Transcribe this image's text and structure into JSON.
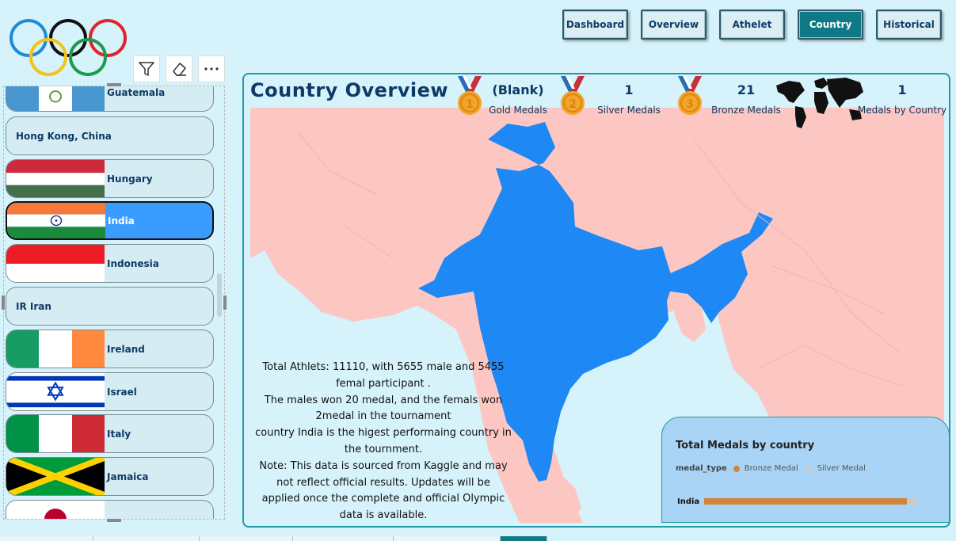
{
  "nav": {
    "items": [
      "Dashboard",
      "Overview",
      "Athelet",
      "Country",
      "Historical"
    ],
    "active": "Country"
  },
  "slicer": {
    "toolbar": [
      "filter-icon",
      "eraser-icon",
      "more-options-icon"
    ],
    "countries": [
      {
        "label": "Guatemala",
        "flag": "guatemala"
      },
      {
        "label": "Hong Kong, China",
        "flag": ""
      },
      {
        "label": "Hungary",
        "flag": "hungary"
      },
      {
        "label": "India",
        "flag": "india",
        "selected": true
      },
      {
        "label": "Indonesia",
        "flag": "indonesia"
      },
      {
        "label": "IR Iran",
        "flag": ""
      },
      {
        "label": "Ireland",
        "flag": "ireland"
      },
      {
        "label": "Israel",
        "flag": "israel"
      },
      {
        "label": "Italy",
        "flag": "italy"
      },
      {
        "label": "Jamaica",
        "flag": "jamaica"
      },
      {
        "label": "",
        "flag": "japan"
      }
    ]
  },
  "panel": {
    "title": "Country Overview",
    "kpis": {
      "gold": {
        "value": "(Blank)",
        "label": "Gold Medals",
        "medal": "1"
      },
      "silver": {
        "value": "1",
        "label": "Silver Medals",
        "medal": "2"
      },
      "bronze": {
        "value": "21",
        "label": "Bronze Medals",
        "medal": "3"
      },
      "by_country": {
        "value": "1",
        "label": "Medals by Country"
      }
    },
    "note_lines": [
      "Total Athlets: 11110, with 5655 male and 5455",
      "femal participant .",
      "The males won 20 medal, and the femals won",
      "2medal in the tournament",
      "country India is the higest performaing country in",
      "the tournment.",
      "Note: This data is sourced from Kaggle and may",
      "not reflect official results. Updates will be",
      "applied once the complete and official Olympic",
      "data is available."
    ]
  },
  "medal_chart": {
    "title": "Total Medals by country",
    "legend_title": "medal_type",
    "legend": [
      {
        "label": "Bronze Medal",
        "color": "#d2843a"
      },
      {
        "label": "Silver Medal",
        "color": "#c9c9c9"
      }
    ]
  },
  "chart_data": {
    "type": "bar",
    "orientation": "horizontal",
    "stacked": true,
    "title": "Total Medals by country",
    "categories": [
      "India"
    ],
    "series": [
      {
        "name": "Bronze Medal",
        "values": [
          21
        ],
        "color": "#d2843a"
      },
      {
        "name": "Silver Medal",
        "values": [
          1
        ],
        "color": "#c9c9c9"
      }
    ],
    "legend_title": "medal_type",
    "legend_position": "top-left"
  },
  "colors": {
    "selected_country": "#1e88f5",
    "other_land": "#fcc7c3",
    "water": "#d6f3fb",
    "accent": "#0f7a86"
  }
}
